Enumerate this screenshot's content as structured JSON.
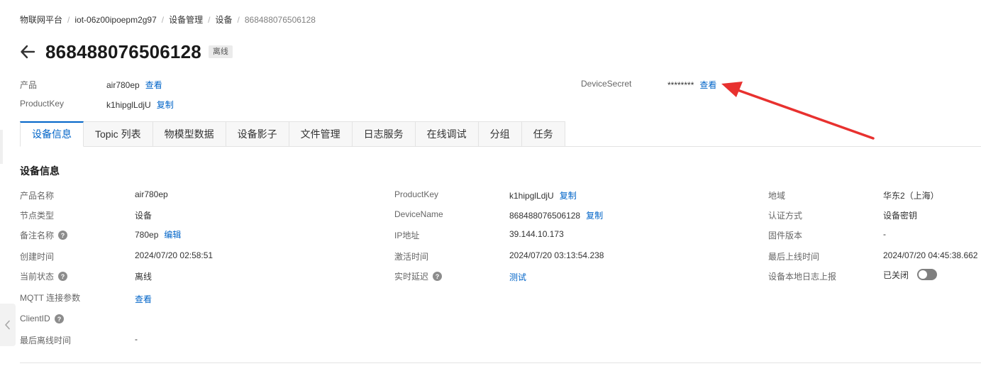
{
  "breadcrumb": {
    "items": [
      "物联网平台",
      "iot-06z00ipoepm2g97",
      "设备管理",
      "设备",
      "868488076506128"
    ],
    "separator": "/"
  },
  "header": {
    "title": "868488076506128",
    "status": "离线"
  },
  "meta": {
    "product_label": "产品",
    "product_value": "air780ep",
    "product_link": "查看",
    "productkey_label": "ProductKey",
    "productkey_value": "k1hipglLdjU",
    "productkey_link": "复制",
    "devicesecret_label": "DeviceSecret",
    "devicesecret_value": "********",
    "devicesecret_link": "查看"
  },
  "tabs": [
    {
      "label": "设备信息",
      "active": true
    },
    {
      "label": "Topic 列表",
      "active": false
    },
    {
      "label": "物模型数据",
      "active": false
    },
    {
      "label": "设备影子",
      "active": false
    },
    {
      "label": "文件管理",
      "active": false
    },
    {
      "label": "日志服务",
      "active": false
    },
    {
      "label": "在线调试",
      "active": false
    },
    {
      "label": "分组",
      "active": false
    },
    {
      "label": "任务",
      "active": false
    }
  ],
  "info": {
    "section_title": "设备信息",
    "col1": {
      "product_name_label": "产品名称",
      "product_name_value": "air780ep",
      "node_type_label": "节点类型",
      "node_type_value": "设备",
      "remark_label": "备注名称",
      "remark_value": "780ep",
      "remark_link": "编辑",
      "created_label": "创建时间",
      "created_value": "2024/07/20 02:58:51",
      "state_label": "当前状态",
      "state_value": "离线",
      "mqtt_label": "MQTT 连接参数",
      "mqtt_link": "查看",
      "clientid_label": "ClientID",
      "last_offline_label": "最后离线时间",
      "last_offline_value": "-"
    },
    "col2": {
      "productkey_label": "ProductKey",
      "productkey_value": "k1hipglLdjU",
      "productkey_link": "复制",
      "devicename_label": "DeviceName",
      "devicename_value": "868488076506128",
      "devicename_link": "复制",
      "ip_label": "IP地址",
      "ip_value": "39.144.10.173",
      "activated_label": "激活时间",
      "activated_value": "2024/07/20 03:13:54.238",
      "latency_label": "实时延迟",
      "latency_link": "测试"
    },
    "col3": {
      "region_label": "地域",
      "region_value": "华东2（上海）",
      "auth_label": "认证方式",
      "auth_value": "设备密钥",
      "firmware_label": "固件版本",
      "firmware_value": "-",
      "last_online_label": "最后上线时间",
      "last_online_value": "2024/07/20 04:45:38.662",
      "local_log_label": "设备本地日志上报",
      "local_log_value": "已关闭",
      "local_log_enabled": false
    }
  },
  "colors": {
    "link": "#0064c8",
    "annotation_arrow": "#e8312f"
  },
  "icons": {
    "back": "arrow-left-icon",
    "help": "question-circle-icon",
    "collapse": "chevron-left-icon"
  }
}
